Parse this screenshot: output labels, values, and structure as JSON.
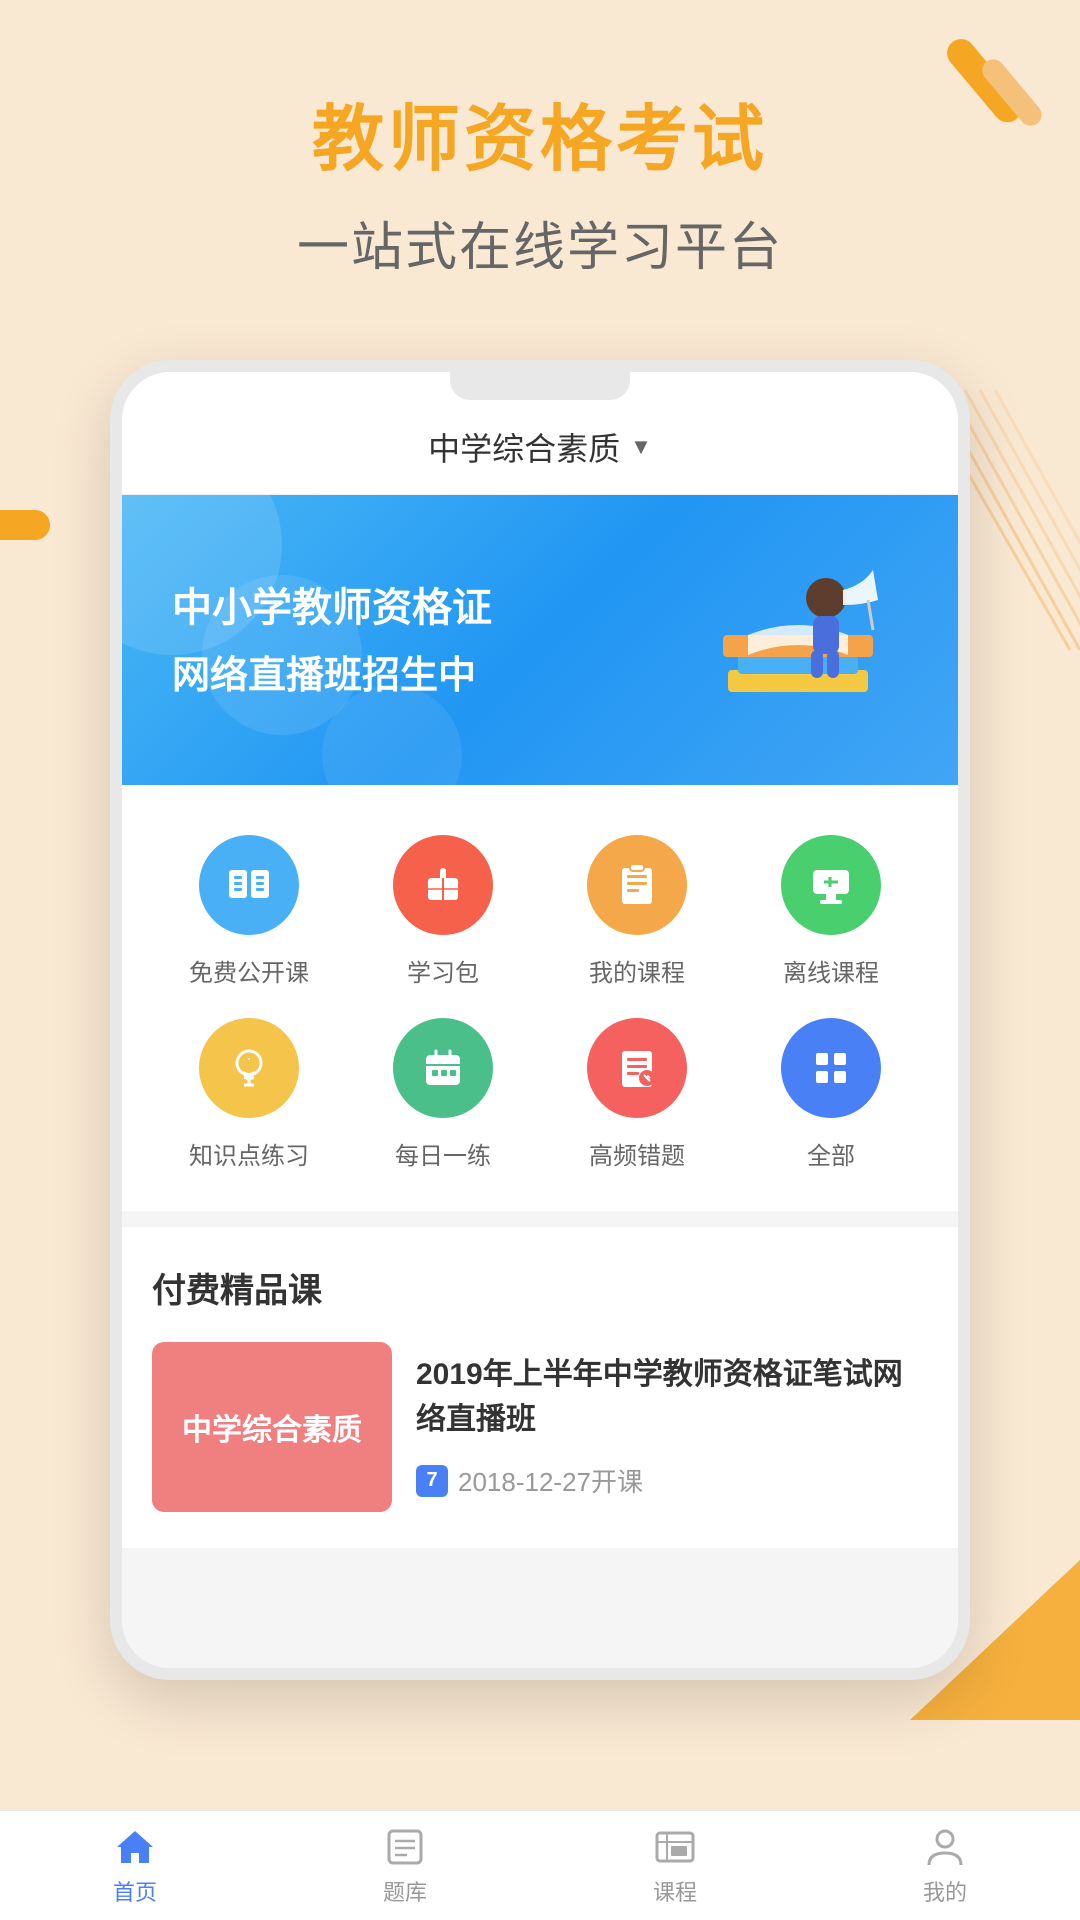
{
  "app": {
    "title": "教师资格考试",
    "subtitle": "一站式在线学习平台"
  },
  "header": {
    "title": "教师资格考试",
    "subtitle": "一站式在线学习平台"
  },
  "phone": {
    "category_selector": {
      "label": "中学综合素质",
      "arrow": "▼"
    },
    "banner": {
      "title": "中小学教师资格证",
      "subtitle": "网络直播班招生中"
    },
    "grid": {
      "row1": [
        {
          "label": "免费公开课",
          "icon": "book",
          "color": "blue"
        },
        {
          "label": "学习包",
          "icon": "gift",
          "color": "red"
        },
        {
          "label": "我的课程",
          "icon": "clipboard",
          "color": "orange"
        },
        {
          "label": "离线课程",
          "icon": "monitor",
          "color": "green"
        }
      ],
      "row2": [
        {
          "label": "知识点练习",
          "icon": "bulb",
          "color": "yellow"
        },
        {
          "label": "每日一练",
          "icon": "calendar",
          "color": "green2"
        },
        {
          "label": "高频错题",
          "icon": "edit",
          "color": "pink"
        },
        {
          "label": "全部",
          "icon": "grid",
          "color": "blue2"
        }
      ]
    },
    "premium_section": {
      "title": "付费精品课",
      "course": {
        "thumbnail_text": "中学综合素质",
        "title": "2019年上半年中学教师资格证笔试网络直播班",
        "date": "2018-12-27开课",
        "date_number": "7"
      }
    }
  },
  "bottom_nav": {
    "items": [
      {
        "label": "首页",
        "active": true
      },
      {
        "label": "题库",
        "active": false
      },
      {
        "label": "课程",
        "active": false
      },
      {
        "label": "我的",
        "active": false
      }
    ]
  }
}
